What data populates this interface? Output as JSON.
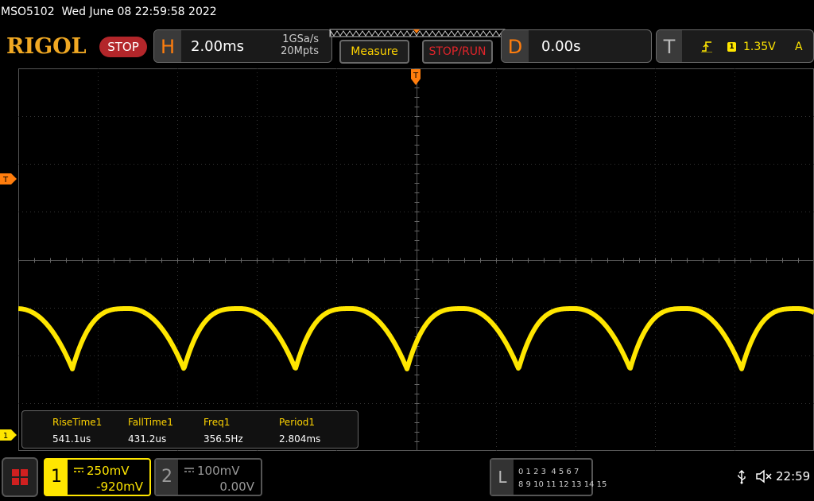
{
  "status": {
    "model": "MSO5102",
    "datetime": "Wed June 08 22:59:58 2022"
  },
  "header": {
    "brand": "RIGOL",
    "run_state": "STOP",
    "horizontal": {
      "letter": "H",
      "timebase": "2.00ms",
      "sample_rate": "1GSa/s",
      "memory_depth": "20Mpts"
    },
    "measure_label": "Measure",
    "stoprun_label": "STOP/RUN",
    "delay": {
      "letter": "D",
      "value": "0.00s"
    },
    "trigger": {
      "letter": "T",
      "source": "1",
      "level": "1.35V",
      "mode": "A",
      "slope_icon": "rising-edge-icon"
    }
  },
  "markers": {
    "trigger_level": "T",
    "channel1": "1"
  },
  "measurements": [
    {
      "name": "RiseTime1",
      "value": "541.1us"
    },
    {
      "name": "FallTime1",
      "value": "431.2us"
    },
    {
      "name": "Freq1",
      "value": "356.5Hz"
    },
    {
      "name": "Period1",
      "value": "2.804ms"
    }
  ],
  "channels": [
    {
      "number": "1",
      "scale": "250mV",
      "offset": "-920mV",
      "coupling_icon": "dc-coupling-icon",
      "color": "#ffe600",
      "active": true
    },
    {
      "number": "2",
      "scale": "100mV",
      "offset": "0.00V",
      "coupling_icon": "dc-coupling-icon",
      "color": "#999999",
      "active": false
    }
  ],
  "logic_analyzer": {
    "letter": "L",
    "row1": "0 1 2 3  4 5 6 7",
    "row2": "8 9 10 11 12 13 14 15"
  },
  "footer": {
    "time": "22:59"
  },
  "colors": {
    "brand": "#f0a823",
    "trace_ch1": "#ffe600",
    "stop_red": "#b3262a",
    "accent_orange": "#ff7d0d"
  }
}
